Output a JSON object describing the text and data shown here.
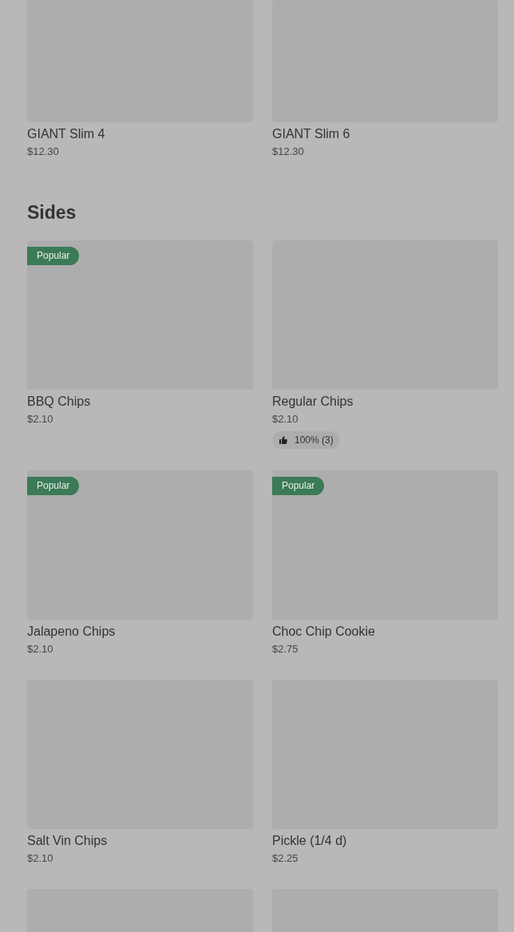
{
  "sections": [
    {
      "items": [
        {
          "kind": "product",
          "name": "GIANT Slim 4",
          "price": "$12.30"
        },
        {
          "kind": "product",
          "name": "GIANT Slim 6",
          "price": "$12.30"
        }
      ]
    },
    {
      "title": "Sides",
      "items": [
        {
          "kind": "product",
          "name": "BBQ Chips",
          "price": "$2.10",
          "badge": "Popular"
        },
        {
          "kind": "product",
          "name": "Regular Chips",
          "price": "$2.10",
          "rating": "100% (3)"
        },
        {
          "kind": "product",
          "name": "Jalapeno Chips",
          "price": "$2.10",
          "badge": "Popular"
        },
        {
          "kind": "product",
          "name": "Choc Chip Cookie",
          "price": "$2.75",
          "badge": "Popular"
        },
        {
          "kind": "product",
          "name": "Salt Vin Chips",
          "price": "$2.10"
        },
        {
          "kind": "product",
          "name": "Pickle (1/4 d)",
          "price": "$2.25"
        },
        {
          "kind": "image_only"
        },
        {
          "kind": "image_only"
        }
      ]
    }
  ]
}
